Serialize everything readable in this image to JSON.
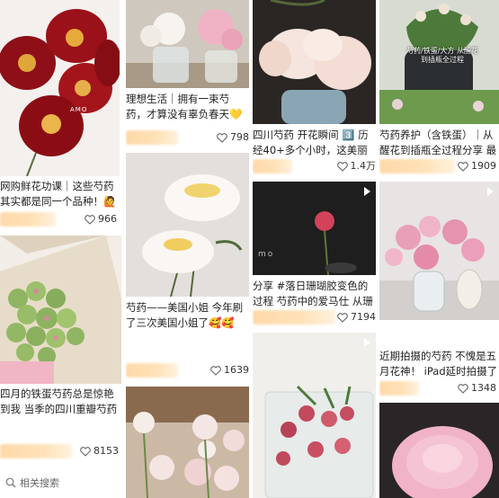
{
  "icons": {
    "like": "heart-icon",
    "video": "play-icon",
    "search": "search-icon"
  },
  "colors": {
    "accent_blur": "#ffd8a8",
    "background": "#ffffff",
    "text": "#222222"
  },
  "cards": [
    {
      "caption": "网购鲜花功课｜这些芍药其实都是同一个品种！🙋",
      "likes": "966",
      "watermark": "AMO"
    },
    {
      "caption": "四月的铁蛋芍药总是惊艳到我 当季的四川重瓣芍药可",
      "likes": "8153"
    },
    {
      "caption": "理想生活｜拥有一束芍药，才算没有辜负春天💛 赶…",
      "likes": "798"
    },
    {
      "caption": "芍药——美国小姐 今年刷了三次美国小姐了🥰🥰🛒…",
      "likes": "1639"
    },
    {
      "caption": "四川芍药 开花瞬间 3️⃣ 历经40+多个小时，这美丽的…",
      "likes": "1.4万"
    },
    {
      "caption": "分享 #落日珊瑚胶变色的过程 芍药中的爱马仕 从珊瑚…",
      "likes": "7194",
      "watermark": "mo"
    },
    {
      "caption": "芍药养护（含铁蛋）｜从醒花到插瓶全过程分享 最爱…",
      "likes": "1909",
      "overlay_text": "芍药/铁蛋/大方 从醒花到插瓶全过程"
    },
    {
      "caption": "近期拍摄的芍药 不愧是五月花神！ iPad延时拍摄了三…",
      "likes": "1348"
    }
  ],
  "search": {
    "label": "相关搜索"
  }
}
